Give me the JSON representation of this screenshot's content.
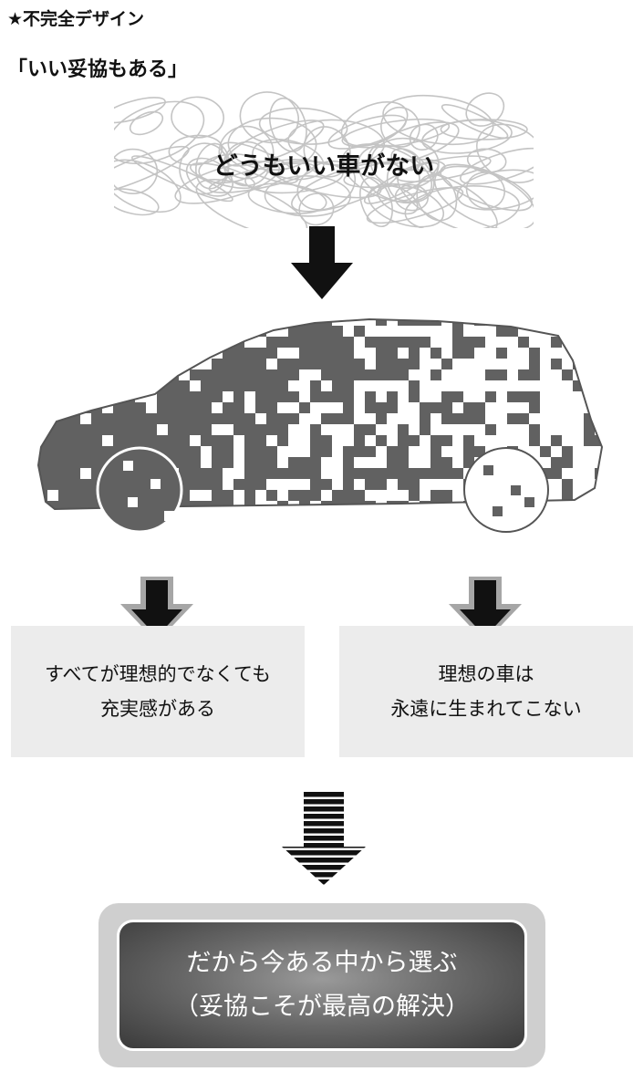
{
  "header": {
    "label": "★不完全デザイン",
    "subtitle": "「いい妥協もある」"
  },
  "cloud": {
    "text": "どうもいい車がない"
  },
  "panels": {
    "left": {
      "line1": "すべてが理想的でなくても",
      "line2": "充実感がある"
    },
    "right": {
      "line1": "理想の車は",
      "line2": "永遠に生まれてこない"
    }
  },
  "result": {
    "line1": "だから今ある中から選ぶ",
    "line2": "（妥協こそが最高の解決）"
  },
  "colors": {
    "car_body": "#616161",
    "panel_bg": "#ececec",
    "result_dark": "#3a3a3a",
    "arrow": "#111111"
  }
}
